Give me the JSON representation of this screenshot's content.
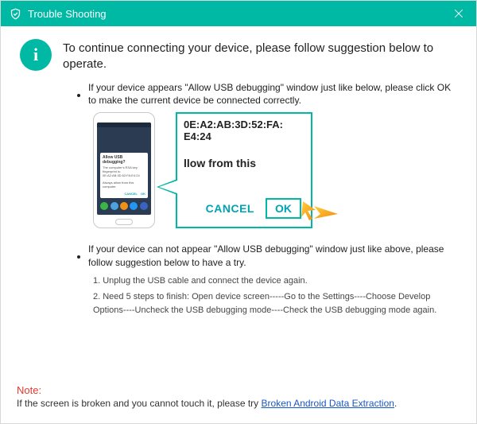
{
  "titlebar": {
    "title": "Trouble Shooting"
  },
  "intro": {
    "text": "To continue connecting your device, please follow suggestion below to operate.",
    "info_glyph": "i"
  },
  "bullets": {
    "item1": "If your device appears \"Allow USB debugging\" window just like below, please click OK to make the current device  be connected correctly.",
    "item2": "If your device can not appear \"Allow USB debugging\" window just like above, please follow suggestion below to have a try."
  },
  "phone_dialog": {
    "title": "Allow USB debugging?",
    "body1": "The computer's RSA key",
    "body2": "fingerprint is:",
    "body3": "0E:A2:AB:3D:52:FA:E4:24",
    "checkbox": "Always allow from this computer",
    "cancel": "CANCEL",
    "ok": "OK"
  },
  "zoom": {
    "mac_line1": "0E:A2:AB:3D:52:FA:",
    "mac_line2": "E4:24",
    "allow_partial": "llow from this",
    "cancel": "CANCEL",
    "ok": "OK"
  },
  "steps": {
    "s1": "1. Unplug the USB cable and connect the device again.",
    "s2": "2. Need 5 steps to finish: Open device screen-----Go to the Settings----Choose Develop Options----Uncheck the USB debugging mode----Check the USB debugging mode again."
  },
  "note": {
    "label": "Note:",
    "text_before": "If the screen is broken and you cannot touch it, please try ",
    "link": "Broken Android Data Extraction",
    "text_after": "."
  }
}
